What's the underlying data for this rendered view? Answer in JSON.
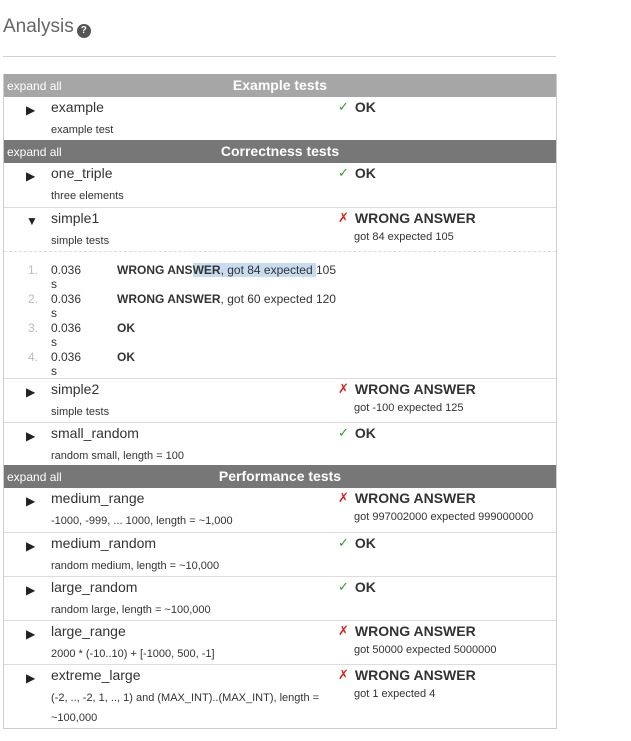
{
  "header": {
    "title": "Analysis",
    "help_icon": "?"
  },
  "sections": {
    "example": {
      "expand_label": "expand all",
      "title": "Example tests"
    },
    "correctness": {
      "expand_label": "expand all",
      "title": "Correctness tests"
    },
    "performance": {
      "expand_label": "expand all",
      "title": "Performance tests"
    }
  },
  "tests": {
    "example": {
      "name": "example",
      "desc": "example test",
      "mark": "✓",
      "status": "OK"
    },
    "one_triple": {
      "name": "one_triple",
      "desc": "three elements",
      "mark": "✓",
      "status": "OK"
    },
    "simple1": {
      "name": "simple1",
      "desc": "simple tests",
      "mark": "✗",
      "status": "WRONG ANSWER",
      "detail": "got 84 expected 105"
    },
    "simple2": {
      "name": "simple2",
      "desc": "simple tests",
      "mark": "✗",
      "status": "WRONG ANSWER",
      "detail": "got -100 expected 125"
    },
    "small_random": {
      "name": "small_random",
      "desc": "random small, length = 100",
      "mark": "✓",
      "status": "OK"
    },
    "medium_range": {
      "name": "medium_range",
      "desc": "-1000, -999, ... 1000, length = ~1,000",
      "mark": "✗",
      "status": "WRONG ANSWER",
      "detail": "got 997002000 expected 999000000"
    },
    "medium_random": {
      "name": "medium_random",
      "desc": "random medium, length = ~10,000",
      "mark": "✓",
      "status": "OK"
    },
    "large_random": {
      "name": "large_random",
      "desc": "random large, length = ~100,000",
      "mark": "✓",
      "status": "OK"
    },
    "large_range": {
      "name": "large_range",
      "desc": "2000 * (-10..10) + [-1000, 500, -1]",
      "mark": "✗",
      "status": "WRONG ANSWER",
      "detail": "got 50000 expected 5000000"
    },
    "extreme_large": {
      "name": "extreme_large",
      "desc": "(-2, .., -2, 1, .., 1) and (MAX_INT)..(MAX_INT), length = ~100,000",
      "mark": "✗",
      "status": "WRONG ANSWER",
      "detail": "got 1 expected 4"
    }
  },
  "simple1_subtests": [
    {
      "num": "1.",
      "time": "0.036 s",
      "result_bold": "WRONG ANS",
      "result_bold_hl": "WER",
      "result_rest_hl": ", got 84 expected ",
      "result_tail": "105"
    },
    {
      "num": "2.",
      "time": "0.036 s",
      "result_bold": "WRONG ANSWER",
      "result_rest": ", got 60 expected 120"
    },
    {
      "num": "3.",
      "time": "0.036 s",
      "result_bold": "OK",
      "result_rest": ""
    },
    {
      "num": "4.",
      "time": "0.036 s",
      "result_bold": "OK",
      "result_rest": ""
    }
  ],
  "icons": {
    "collapsed": "▶",
    "expanded": "▼",
    "ok_color": "#2aa02a",
    "fail_color": "#dd2222"
  }
}
